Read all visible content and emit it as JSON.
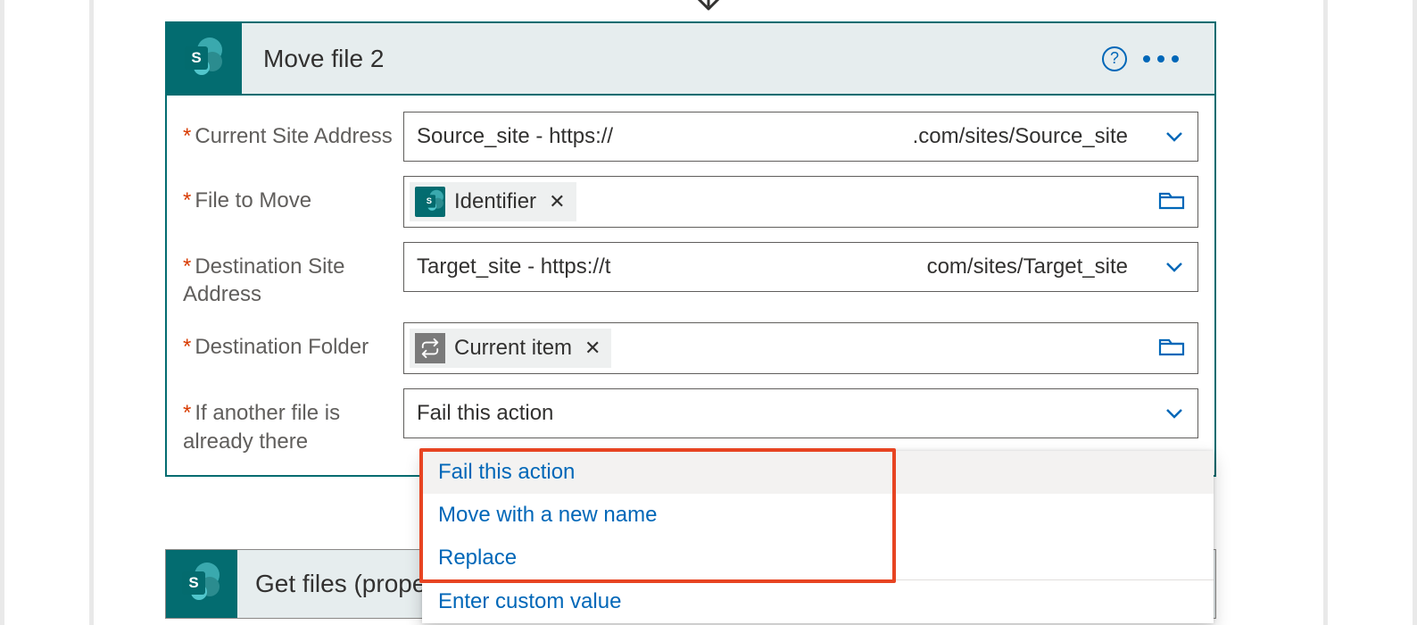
{
  "card": {
    "title": "Move file 2",
    "fields": {
      "currentSite": {
        "label": "Current Site Address",
        "value_left": "Source_site - https://",
        "value_right": ".com/sites/Source_site"
      },
      "fileToMove": {
        "label": "File to Move",
        "token": "Identifier"
      },
      "destSite": {
        "label": "Destination Site Address",
        "value_left": "Target_site - https://t",
        "value_right": "com/sites/Target_site"
      },
      "destFolder": {
        "label": "Destination Folder",
        "token": "Current item"
      },
      "conflict": {
        "label": "If another file is already there",
        "selected": "Fail this action",
        "options": [
          "Fail this action",
          "Move with a new name",
          "Replace"
        ],
        "custom": "Enter custom value"
      }
    }
  },
  "card2": {
    "title": "Get files (prope"
  }
}
